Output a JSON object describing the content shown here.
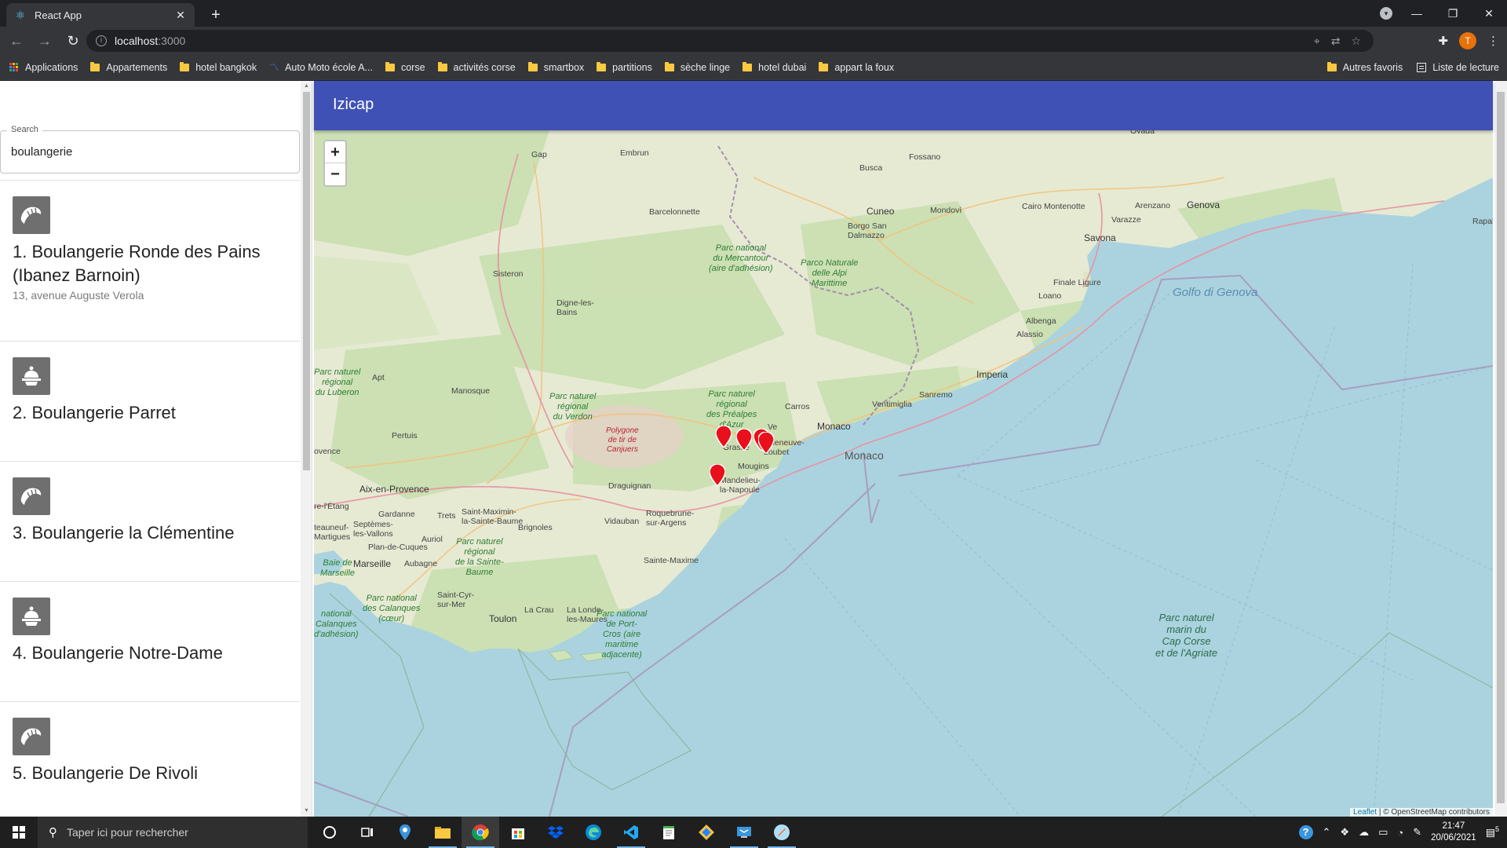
{
  "browser": {
    "tab_title": "React App",
    "url_host": "localhost",
    "url_port": ":3000",
    "profile_initial": "T",
    "bookmarks": [
      {
        "label": "Applications",
        "kind": "apps"
      },
      {
        "label": "Appartements",
        "kind": "folder"
      },
      {
        "label": "hotel bangkok",
        "kind": "folder"
      },
      {
        "label": "Auto Moto école A...",
        "kind": "site"
      },
      {
        "label": "corse",
        "kind": "folder"
      },
      {
        "label": "activités corse",
        "kind": "folder"
      },
      {
        "label": "smartbox",
        "kind": "folder"
      },
      {
        "label": "partitions",
        "kind": "folder"
      },
      {
        "label": "sèche linge",
        "kind": "folder"
      },
      {
        "label": "hotel dubai",
        "kind": "folder"
      },
      {
        "label": "appart la foux",
        "kind": "folder"
      }
    ],
    "other_bookmarks": "Autres favoris",
    "reading_list": "Liste de lecture"
  },
  "app": {
    "title": "Izicap",
    "search": {
      "label": "Search",
      "value": "boulangerie"
    },
    "results": [
      {
        "title": "1. Boulangerie Ronde des Pains (Ibanez Barnoin)",
        "address": "13, avenue Auguste Verola",
        "icon": "croissant-icon"
      },
      {
        "title": "2. Boulangerie Parret",
        "address": "",
        "icon": "cake-icon"
      },
      {
        "title": "3. Boulangerie la Clémentine",
        "address": "",
        "icon": "croissant-icon"
      },
      {
        "title": "4. Boulangerie Notre-Dame",
        "address": "",
        "icon": "cake-icon"
      },
      {
        "title": "5. Boulangerie De Rivoli",
        "address": "",
        "icon": "croissant-icon"
      }
    ]
  },
  "map": {
    "zoom_in": "+",
    "zoom_out": "−",
    "labels": {
      "gap": "Gap",
      "embrun": "Embrun",
      "barcelonnette": "Barcelonnette",
      "sisteron": "Sisteron",
      "digne": "Digne-les-\nBains",
      "apt": "Apt",
      "manosque": "Manosque",
      "pertuis": "Pertuis",
      "aix": "Aix-en-Provence",
      "marseille": "Marseille",
      "toulon": "Toulon",
      "draguignan": "Draguignan",
      "grasse": "Grasse",
      "carros": "Carros",
      "cuneo": "Cuneo",
      "borgo": "Borgo San\nDalmazzo",
      "savona": "Savona",
      "genova": "Genova",
      "imperia": "Imperia",
      "sanremo": "Sanremo",
      "ventimiglia": "Ventimiglia",
      "monaco": "Monaco",
      "monaco_sea": "Monaco",
      "busca": "Busca",
      "fossano": "Fossano",
      "mondovi": "Mondovì",
      "cairo": "Cairo Montenotte",
      "varazze": "Varazze",
      "arenzano": "Arenzano",
      "finale": "Finale Ligure",
      "loano": "Loano",
      "albenga": "Albenga",
      "alassio": "Alassio",
      "villeneuve": "Villeneuve-\nLoubet",
      "mougins": "Mougins",
      "mandelieu": "Mandelieu-\nla-Napoule",
      "vidauban": "Vidauban",
      "brignoles": "Brignoles",
      "roquebrune": "Roquebrune-\nsur-Argens",
      "sainte_maxime": "Sainte-Maxime",
      "lacrau": "La Crau",
      "londe": "La Londe-\nles-Maures",
      "saint_cyr": "Saint-Cyr-\nsur-Mer",
      "aubagne": "Aubagne",
      "gardanne": "Gardanne",
      "trets": "Trets",
      "saint_maximin": "Saint-Maximin-\nla-Sainte-Baume",
      "auriol": "Auriol",
      "plan_de_cuques": "Plan-de-Cuques",
      "septemes": "Septèmes-\nles-Vallons",
      "etang": "re-l'Étang",
      "martigues": "teauneuf-\nMartigues",
      "rapallo": "Rapal",
      "ovada": "Ovada",
      "venise": "Ve",
      "rovence": "ovence",
      "golfo": "Golfo di Genova",
      "pn_mercantour": "Parc national\ndu Mercantour\n(aire d'adhésion)",
      "pn_alpi": "Parco Naturale\ndelle Alpi\nMarittime",
      "pn_luberon": "Parc naturel\nrégional\ndu Luberon",
      "pn_verdon": "Parc naturel\nrégional\ndu Verdon",
      "pn_prealpes": "Parc naturel\nrégional\ndes Préalpes\nd'Azur",
      "pn_sainte_baume": "Parc naturel\nrégional\nde la Sainte-\nBaume",
      "pn_calanques": "Parc national\ndes Calanques\n(cœur)",
      "pn_calanques2": "national\nCalanques\nd'adhésion)",
      "pn_portcros": "Parc national\nde Port-\nCros (aire\nmaritime\nadjacente)",
      "pn_capcorse": "Parc naturel\nmarin du\nCap Corse\net de l'Agriate",
      "baie": "Baie de\nMarseille",
      "polygone": "Polygone\nde tir de\nCanjuers"
    },
    "attribution_leaflet": "Leaflet",
    "attribution_osm": "© OpenStreetMap contributors",
    "marker_color": "#e8101c"
  },
  "taskbar": {
    "search_placeholder": "Taper ici pour rechercher",
    "time": "21:47",
    "date": "20/06/2021",
    "notifications": "5"
  },
  "colors": {
    "header": "#3f51b5",
    "sea": "#aad3df",
    "land": "#e8ecd8"
  }
}
